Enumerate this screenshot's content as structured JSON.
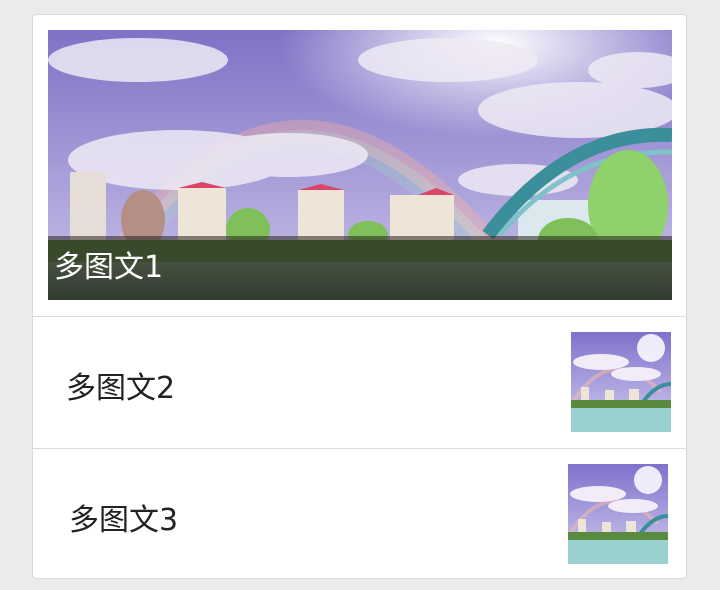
{
  "articles": [
    {
      "title": "多图文1"
    },
    {
      "title": "多图文2"
    },
    {
      "title": "多图文3"
    }
  ],
  "colors": {
    "background": "#ebebeb",
    "card": "#ffffff",
    "divider": "#dcdcdc",
    "caption_overlay": "#28231e"
  }
}
